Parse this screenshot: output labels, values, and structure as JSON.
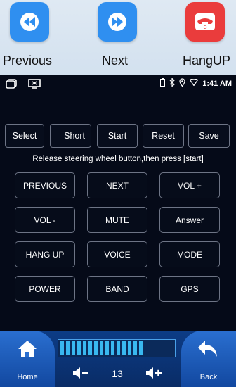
{
  "legend": [
    {
      "label": "Previous",
      "icon": "skip-back-icon",
      "color": "#2f8ff0"
    },
    {
      "label": "Next",
      "icon": "skip-forward-icon",
      "color": "#2f8ff0"
    },
    {
      "label": "HangUP",
      "icon": "hang-up-icon",
      "color": "#ea3c3c"
    }
  ],
  "status": {
    "time": "1:41 AM"
  },
  "toolbar": {
    "select": "Select",
    "short": "Short",
    "start": "Start",
    "reset": "Reset",
    "save": "Save"
  },
  "instruction": "Release steering wheel button,then press [start]",
  "keys": [
    "PREVIOUS",
    "NEXT",
    "VOL +",
    "VOL -",
    "MUTE",
    "Answer",
    "HANG UP",
    "VOICE",
    "MODE",
    "POWER",
    "BAND",
    "GPS"
  ],
  "dock": {
    "home_label": "Home",
    "back_label": "Back",
    "volume": "13",
    "volume_level": 0.75
  }
}
